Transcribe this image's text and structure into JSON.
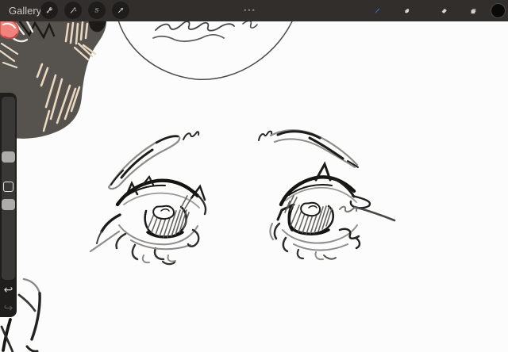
{
  "toolbar": {
    "gallery_label": "Gallery",
    "overflow_glyph": "•••",
    "selection_glyph": "S",
    "bar_color": "#312e2c",
    "button_circle_color": "#1f1d1c",
    "icon_color": "#bab8b6",
    "accent_color": "#2e78e2",
    "current_color_swatch": "#0a0a0a",
    "left_tools": [
      {
        "id": "gallery",
        "label": "Gallery"
      },
      {
        "id": "actions",
        "icon": "wrench-icon"
      },
      {
        "id": "adjustments",
        "icon": "magic-wand-icon"
      },
      {
        "id": "selection",
        "icon": "selection-s-icon"
      },
      {
        "id": "transform",
        "icon": "transform-arrow-icon"
      }
    ],
    "right_tools": [
      {
        "id": "paint",
        "icon": "paint-brush-icon",
        "selected": true
      },
      {
        "id": "smudge",
        "icon": "smudge-finger-icon",
        "selected": false
      },
      {
        "id": "erase",
        "icon": "eraser-icon",
        "selected": false
      },
      {
        "id": "layers",
        "icon": "layers-icon",
        "selected": false
      },
      {
        "id": "color",
        "icon": "color-swatch",
        "selected": false
      }
    ]
  },
  "sidebar": {
    "undo_glyph": "↩",
    "redo_glyph": "↪",
    "panel_color": "#201e1d",
    "track_color": "#3a3836",
    "handle_color": "#aeacaa",
    "controls": [
      "brush-size-slider",
      "modify-button",
      "opacity-slider",
      "undo-button",
      "redo-button"
    ]
  },
  "canvas": {
    "background": "#fcfcfc",
    "content": "hand-drawn sketch of two half-closed eyes with hatched irises, partial circle with scribbles at top, dark gray painted blob with beige hatching and red shape in top-left corner, stroke fragments in bottom-left corner",
    "ink_dark": "#1b1b19",
    "ink_gray": "#8e8c8a",
    "blob_color": "#56524e",
    "hatch_color": "#ead7c0",
    "red_color": "#f0837b"
  }
}
